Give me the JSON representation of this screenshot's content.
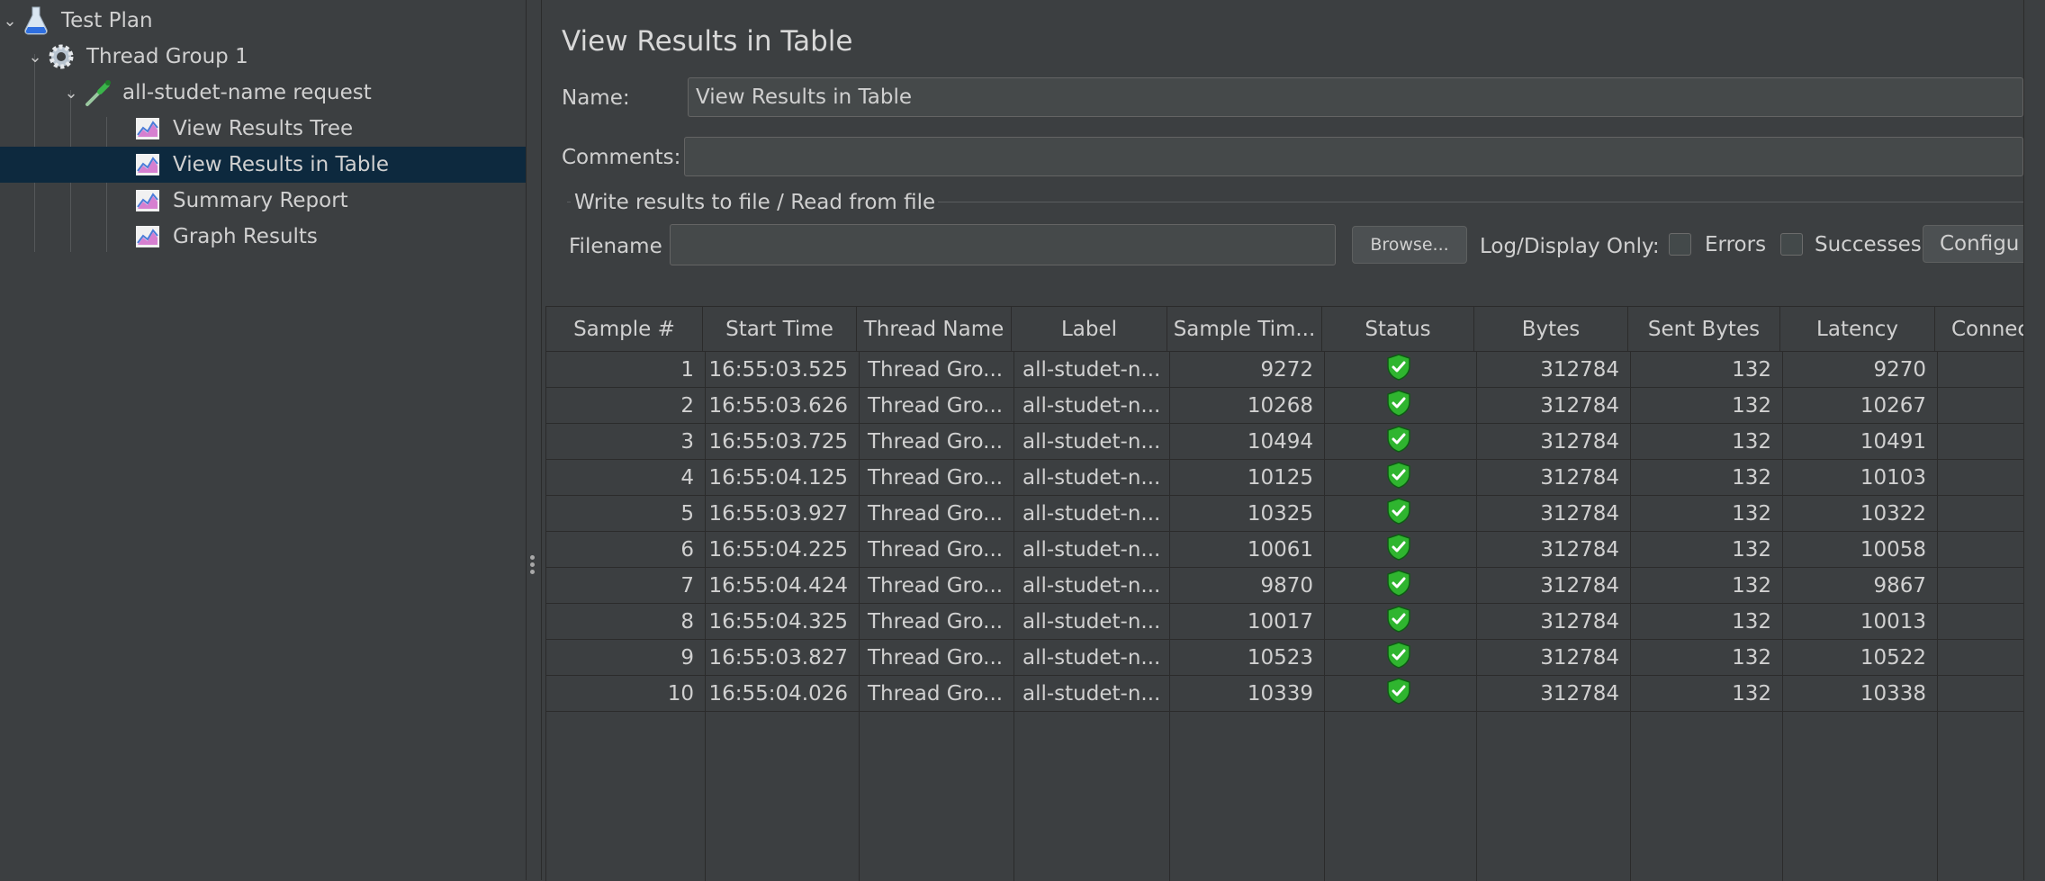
{
  "tree": {
    "items": [
      {
        "label": "Test Plan",
        "icon": "flask-icon",
        "expand": "chevron-down-icon"
      },
      {
        "label": "Thread Group 1",
        "icon": "gear-icon",
        "expand": "chevron-down-icon"
      },
      {
        "label": "all-studet-name request",
        "icon": "pipette-icon",
        "expand": "chevron-down-icon"
      },
      {
        "label": "View Results Tree",
        "icon": "listener-chart-icon"
      },
      {
        "label": "View Results in Table",
        "icon": "listener-chart-icon",
        "selected": true
      },
      {
        "label": "Summary Report",
        "icon": "listener-chart-icon"
      },
      {
        "label": "Graph Results",
        "icon": "listener-chart-icon"
      }
    ]
  },
  "panel": {
    "title": "View Results in Table",
    "name_label": "Name:",
    "name_value": "View Results in Table",
    "comments_label": "Comments:",
    "comments_value": "",
    "file_group_title": "Write results to file / Read from file",
    "filename_label": "Filename",
    "filename_value": "",
    "browse_label": "Browse...",
    "log_display_label": "Log/Display Only:",
    "errors_label": "Errors",
    "successes_label": "Successes",
    "configure_label": "Configu"
  },
  "table": {
    "columns": [
      "Sample #",
      "Start Time",
      "Thread Name",
      "Label",
      "Sample Tim...",
      "Status",
      "Bytes",
      "Sent Bytes",
      "Latency",
      "Connec"
    ],
    "status_icon": "success-shield-icon",
    "rows": [
      {
        "sample": "1",
        "start": "16:55:03.525",
        "thread": "Thread Gro...",
        "label": "all-studet-n...",
        "time": "9272",
        "bytes": "312784",
        "sent": "132",
        "latency": "9270"
      },
      {
        "sample": "2",
        "start": "16:55:03.626",
        "thread": "Thread Gro...",
        "label": "all-studet-n...",
        "time": "10268",
        "bytes": "312784",
        "sent": "132",
        "latency": "10267"
      },
      {
        "sample": "3",
        "start": "16:55:03.725",
        "thread": "Thread Gro...",
        "label": "all-studet-n...",
        "time": "10494",
        "bytes": "312784",
        "sent": "132",
        "latency": "10491"
      },
      {
        "sample": "4",
        "start": "16:55:04.125",
        "thread": "Thread Gro...",
        "label": "all-studet-n...",
        "time": "10125",
        "bytes": "312784",
        "sent": "132",
        "latency": "10103"
      },
      {
        "sample": "5",
        "start": "16:55:03.927",
        "thread": "Thread Gro...",
        "label": "all-studet-n...",
        "time": "10325",
        "bytes": "312784",
        "sent": "132",
        "latency": "10322"
      },
      {
        "sample": "6",
        "start": "16:55:04.225",
        "thread": "Thread Gro...",
        "label": "all-studet-n...",
        "time": "10061",
        "bytes": "312784",
        "sent": "132",
        "latency": "10058"
      },
      {
        "sample": "7",
        "start": "16:55:04.424",
        "thread": "Thread Gro...",
        "label": "all-studet-n...",
        "time": "9870",
        "bytes": "312784",
        "sent": "132",
        "latency": "9867"
      },
      {
        "sample": "8",
        "start": "16:55:04.325",
        "thread": "Thread Gro...",
        "label": "all-studet-n...",
        "time": "10017",
        "bytes": "312784",
        "sent": "132",
        "latency": "10013"
      },
      {
        "sample": "9",
        "start": "16:55:03.827",
        "thread": "Thread Gro...",
        "label": "all-studet-n...",
        "time": "10523",
        "bytes": "312784",
        "sent": "132",
        "latency": "10522"
      },
      {
        "sample": "10",
        "start": "16:55:04.026",
        "thread": "Thread Gro...",
        "label": "all-studet-n...",
        "time": "10339",
        "bytes": "312784",
        "sent": "132",
        "latency": "10338"
      }
    ]
  },
  "colors": {
    "background": "#3c3f41",
    "selection": "#0d293e",
    "status_success": "#2fb52f"
  }
}
